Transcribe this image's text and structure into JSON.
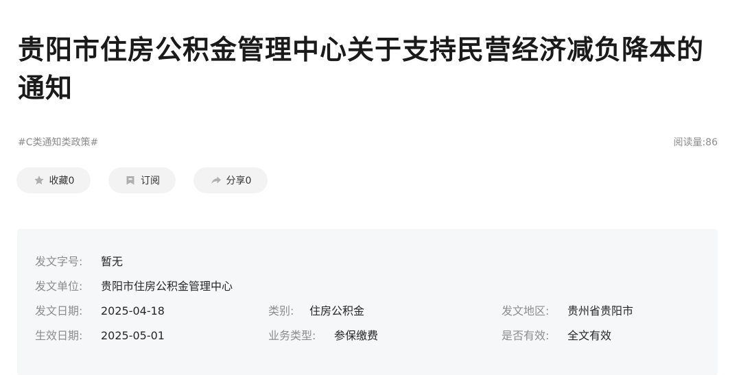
{
  "article": {
    "title": "贵阳市住房公积金管理中心关于支持民营经济减负降本的通知",
    "tag": "#C类通知类政策#",
    "read_count": "阅读量:86"
  },
  "actions": {
    "favorite": {
      "label": "收藏0",
      "icon": "star-icon"
    },
    "subscribe": {
      "label": "订阅",
      "icon": "bookmark-icon"
    },
    "share": {
      "label": "分享0",
      "icon": "share-arrow-icon"
    }
  },
  "info": {
    "doc_number": {
      "label": "发文字号:",
      "value": "暂无"
    },
    "issuer": {
      "label": "发文单位:",
      "value": "贵阳市住房公积金管理中心"
    },
    "issue_date": {
      "label": "发文日期:",
      "value": "2025-04-18"
    },
    "category": {
      "label": "类别:",
      "value": "住房公积金"
    },
    "region": {
      "label": "发文地区:",
      "value": "贵州省贵阳市"
    },
    "effective_date": {
      "label": "生效日期:",
      "value": "2025-05-01"
    },
    "business_type": {
      "label": "业务类型:",
      "value": "参保缴费"
    },
    "validity": {
      "label": "是否有效:",
      "value": "全文有效"
    }
  },
  "colors": {
    "pill_bg": "#f3f3f3",
    "info_bg": "#f6f7f8",
    "muted_text": "#8c8c8c",
    "icon": "#b0b0b0"
  }
}
